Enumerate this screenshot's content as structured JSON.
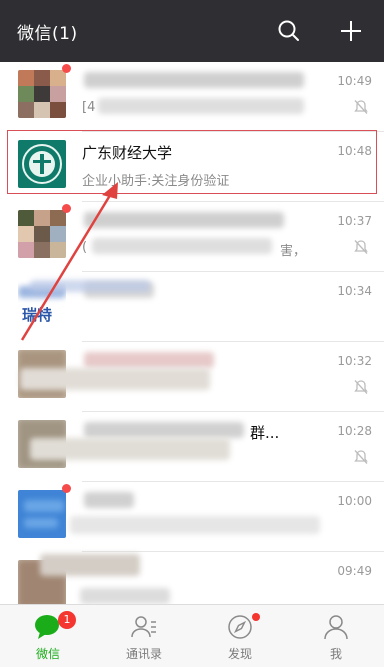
{
  "header": {
    "title": "微信(1)",
    "search_icon": "search-icon",
    "add_icon": "plus-icon"
  },
  "chats": [
    {
      "name": "",
      "preview": "[4",
      "time": "10:49",
      "muted": true,
      "unread_dot": true
    },
    {
      "name": "广东财经大学",
      "preview": "企业小助手:关注身份验证",
      "time": "10:48",
      "muted": false,
      "unread_dot": false,
      "highlighted": true
    },
    {
      "name": "",
      "preview": "(",
      "preview_tail": "害，",
      "time": "10:37",
      "muted": true,
      "unread_dot": true
    },
    {
      "name": "",
      "preview": "",
      "avatar_text": "瑞特",
      "time": "10:34",
      "muted": false,
      "unread_dot": false
    },
    {
      "name": "",
      "preview": "",
      "time": "10:32",
      "muted": true,
      "unread_dot": false
    },
    {
      "name": "",
      "preview": "",
      "name_tail": "群...",
      "time": "10:28",
      "muted": true,
      "unread_dot": false
    },
    {
      "name": "",
      "preview": "",
      "time": "10:00",
      "muted": false,
      "unread_dot": true
    },
    {
      "name": "",
      "preview": "",
      "time": "09:49",
      "muted": false,
      "unread_dot": false
    }
  ],
  "tabs": [
    {
      "label": "微信",
      "icon": "chat-icon",
      "badge": "1",
      "active": true
    },
    {
      "label": "通讯录",
      "icon": "contacts-icon",
      "badge": "",
      "active": false
    },
    {
      "label": "发现",
      "icon": "compass-icon",
      "badge": "",
      "dot": true,
      "active": false
    },
    {
      "label": "我",
      "icon": "person-icon",
      "badge": "",
      "active": false
    }
  ],
  "colors": {
    "topbar": "#2f2e33",
    "accent": "#1aad19",
    "badge": "#f43530",
    "highlight": "#d94f55"
  }
}
